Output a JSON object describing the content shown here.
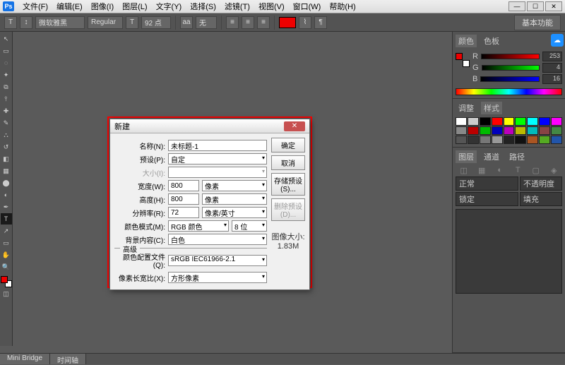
{
  "menu": {
    "file": "文件(F)",
    "edit": "编辑(E)",
    "image": "图像(I)",
    "layer": "图层(L)",
    "type": "文字(Y)",
    "select": "选择(S)",
    "filter": "滤镜(T)",
    "view": "视图(V)",
    "window": "窗口(W)",
    "help": "帮助(H)"
  },
  "options": {
    "font": "微软雅黑",
    "style": "Regular",
    "size": "92 点",
    "workspace": "基本功能"
  },
  "colors": {
    "color_tab": "颜色",
    "swatch_tab": "色板",
    "r_label": "R",
    "g_label": "G",
    "b_label": "B",
    "r": "253",
    "g": "4",
    "b": "16"
  },
  "swatches_panel": {
    "tab1": "调整",
    "tab2": "样式",
    "items": [
      "#fff",
      "#ccc",
      "#000",
      "#f00",
      "#ff0",
      "#0f0",
      "#0ff",
      "#00f",
      "#f0f",
      "#888",
      "#b00",
      "#0b0",
      "#00b",
      "#b0b",
      "#bb0",
      "#0bb",
      "#844",
      "#484",
      "#555",
      "#333",
      "#777",
      "#999",
      "#222",
      "#111",
      "#a52",
      "#5a2",
      "#25a"
    ]
  },
  "layers": {
    "tab1": "图层",
    "tab2": "通道",
    "tab3": "路径",
    "blend": "正常",
    "opacity_label": "不透明度",
    "lock_label": "锁定",
    "fill_label": "填充"
  },
  "dialog": {
    "title": "新建",
    "labels": {
      "name": "名称(N):",
      "preset": "预设(P):",
      "size": "大小(I):",
      "width": "宽度(W):",
      "height": "高度(H):",
      "resolution": "分辨率(R):",
      "colormode": "颜色模式(M):",
      "bgcontents": "背景内容(C):",
      "advanced": "高级",
      "profile": "颜色配置文件(Q):",
      "aspect": "像素长宽比(X):"
    },
    "values": {
      "name": "未标题-1",
      "preset": "自定",
      "width": "800",
      "height": "800",
      "resolution": "72",
      "wunit": "像素",
      "hunit": "像素",
      "runit": "像素/英寸",
      "colormode": "RGB 颜色",
      "bitdepth": "8 位",
      "bgcontents": "白色",
      "profile": "sRGB IEC61966-2.1",
      "aspect": "方形像素"
    },
    "imagesize_label": "图像大小:",
    "imagesize": "1.83M",
    "buttons": {
      "ok": "确定",
      "cancel": "取消",
      "save": "存储预设(S)...",
      "delete": "删除预设(D)..."
    }
  },
  "status": {
    "minibridge": "Mini Bridge",
    "timeline": "时间轴"
  }
}
